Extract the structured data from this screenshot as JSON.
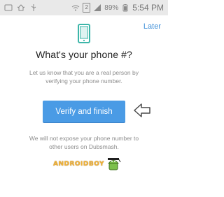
{
  "status_bar": {
    "battery_percent_text": "89%",
    "time": "5:54 PM",
    "sim_badge": "2"
  },
  "header": {
    "later_label": "Later"
  },
  "content": {
    "title": "What's your phone #?",
    "description": "Let us know that you are a real person by verifying your phone number.",
    "cta_label": "Verify and finish",
    "privacy_note": "We will not expose your phone number to other users on Dubsmash."
  },
  "watermark": {
    "text": "ANDROIDBOY"
  },
  "icons": {
    "phone": "smartphone-icon",
    "arrow": "left-arrow-icon"
  },
  "colors": {
    "accent": "#4a9be5",
    "link": "#3f8fd8",
    "title": "#222222",
    "muted": "#8b8b8b"
  }
}
